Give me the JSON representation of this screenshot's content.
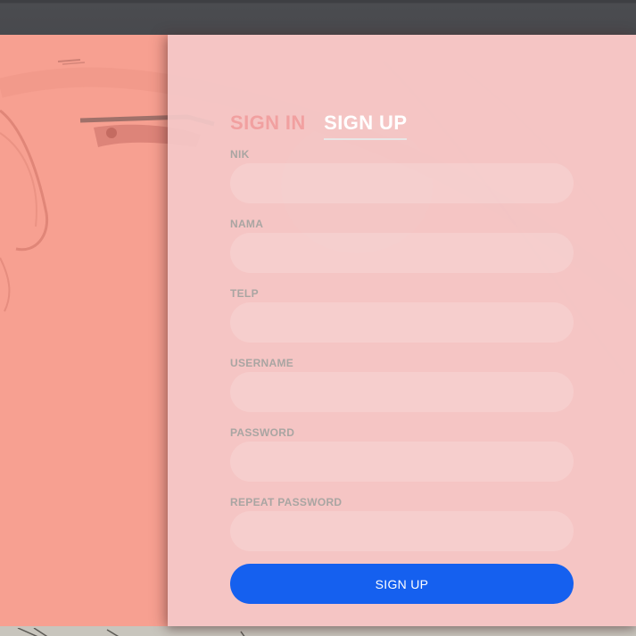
{
  "tabs": {
    "sign_in": "SIGN IN",
    "sign_up": "SIGN UP"
  },
  "fields": [
    {
      "label": "NIK",
      "value": "",
      "type": "text"
    },
    {
      "label": "NAMA",
      "value": "",
      "type": "text"
    },
    {
      "label": "TELP",
      "value": "",
      "type": "text"
    },
    {
      "label": "USERNAME",
      "value": "",
      "type": "text"
    },
    {
      "label": "PASSWORD",
      "value": "",
      "type": "password"
    },
    {
      "label": "REPEAT PASSWORD",
      "value": "",
      "type": "password"
    }
  ],
  "submit": {
    "label": "SIGN UP"
  },
  "colors": {
    "background_salmon": "#f7a091",
    "form_panel": "#f4c8c8",
    "tab_inactive": "#f1a0a0",
    "tab_active": "#ffffff",
    "label": "#a9a5a2",
    "button": "#1560ef"
  }
}
